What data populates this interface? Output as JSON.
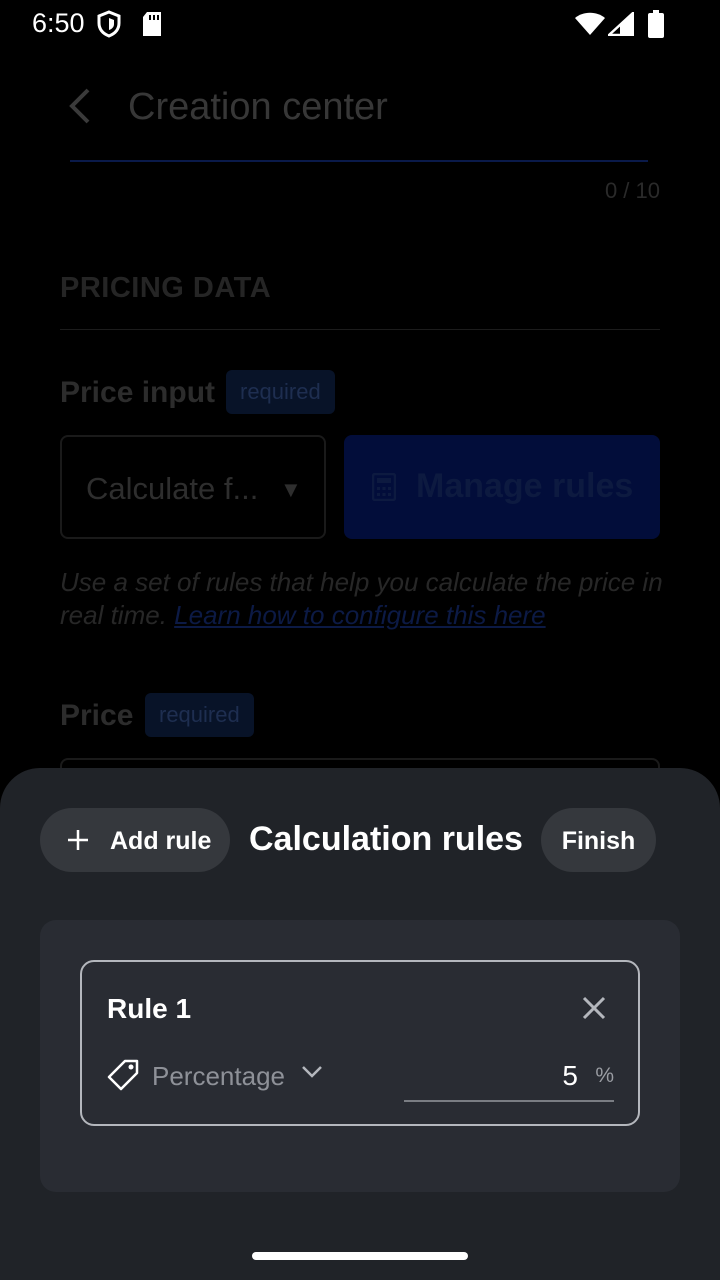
{
  "status_bar": {
    "time": "6:50",
    "icons": [
      "shield-icon",
      "sd-card-icon",
      "wifi-icon",
      "signal-icon",
      "battery-icon"
    ]
  },
  "background_page": {
    "title": "Creation center",
    "counter": "0 / 10",
    "section_title": "PRICING DATA",
    "price_input_label": "Price input",
    "price_input_badge": "required",
    "select_value": "Calculate f...",
    "manage_rules_label": "Manage rules",
    "help_text": "Use a set of rules that help you calculate the price in real time. ",
    "help_link": "Learn how to configure this here",
    "price_label": "Price",
    "price_badge": "required"
  },
  "sheet": {
    "add_rule_label": "Add rule",
    "title": "Calculation rules",
    "finish_label": "Finish",
    "rules": [
      {
        "title": "Rule 1",
        "type": "Percentage",
        "value": "5",
        "unit": "%"
      }
    ]
  },
  "colors": {
    "sheet_background": "#202328",
    "panel_background": "#292c33",
    "pill_button": "#35383d",
    "accent_dimmed": "#020d3a"
  }
}
